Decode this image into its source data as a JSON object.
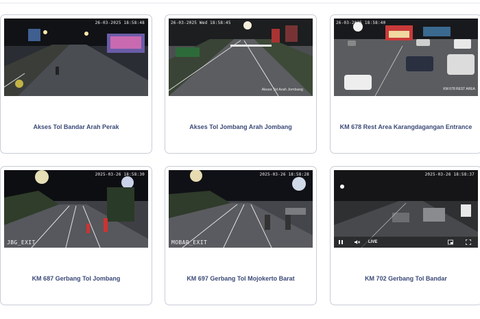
{
  "cameras": [
    {
      "title": "Akses Tol Bandar Arah Perak",
      "timestamp": "26-03-2025 18:58:48",
      "timestamp_pos": "right",
      "overlay_exit": "",
      "overlay_caption": ""
    },
    {
      "title": "Akses Tol Jombang Arah Jombang",
      "timestamp": "26-03-2025 Wed 18:58:45",
      "timestamp_pos": "left",
      "overlay_exit": "",
      "overlay_caption": "Akses Tol Arah Jombang"
    },
    {
      "title": "KM 678 Rest Area Karangdagangan Entrance",
      "timestamp": "26-03-2025 18:58:40",
      "timestamp_pos": "left",
      "overlay_exit": "",
      "overlay_caption": "KM 678 REST AREA"
    },
    {
      "title": "KM 687 Gerbang Tol Jombang",
      "timestamp": "2025-03-26 18:58:30",
      "timestamp_pos": "right",
      "overlay_exit": "JBG_EXIT",
      "overlay_caption": ""
    },
    {
      "title": "KM 697 Gerbang Tol Mojokerto Barat",
      "timestamp": "2025-03-26 18:58:28",
      "timestamp_pos": "right",
      "overlay_exit": "MOBAR_EXIT",
      "overlay_caption": ""
    },
    {
      "title": "KM 702 Gerbang Tol Bandar",
      "timestamp": "2025-03-26 18:58:37",
      "timestamp_pos": "right",
      "overlay_exit": "",
      "overlay_caption": "",
      "player": {
        "live_label": "LIVE"
      }
    }
  ]
}
